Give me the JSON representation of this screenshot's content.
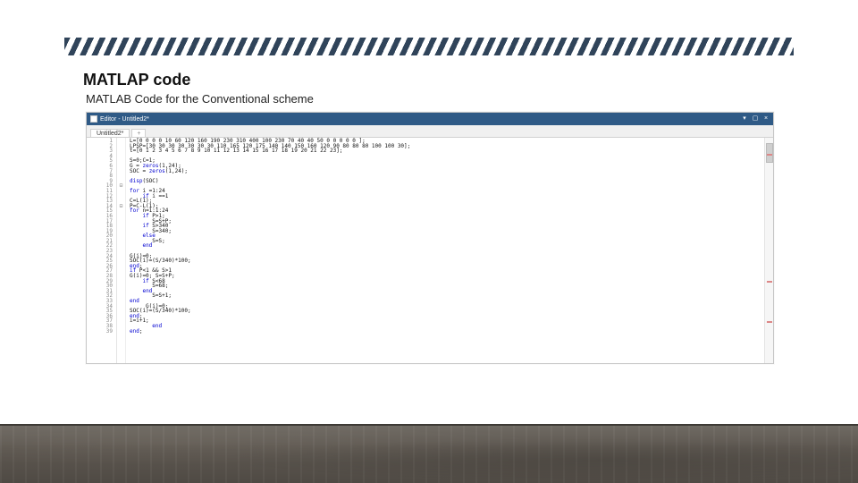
{
  "title": "MATLAP code",
  "subtitle": "MATLAB Code for the Conventional scheme",
  "editor": {
    "windowLabel": "Editor - Untitled2*",
    "min": "▾",
    "max": "▢",
    "close": "×",
    "tab": "Untitled2*",
    "tabPlus": "+",
    "lines": [
      "L=[0 0 0 0 10 60 120 160 190 230 310 400 100 230 70 40 40 50 0 0 0 0 0 ];",
      "LPSP=[30 30 30 30 30 30 30 110 165 120 175 140 140 150 160 120 90 80 80 80 100 100 30];",
      "t=[0 1 2 3 4 5 6 7 8 9 10 11 12 13 14 15 16 17 18 19 20 21 22 23];",
      "",
      "S=0;C=1;",
      "G = zeros(1,24);",
      "SOC = zeros(1,24);",
      "",
      "disp(SOC)",
      "",
      "for i =1:24",
      "    if i ==1",
      "C=L(1);",
      "P=C-L(1);",
      "for n=1:1:24",
      "    if P>1;",
      "       S=S+P;",
      "    if S>340",
      "       S=340;",
      "    else",
      "       S=S;",
      "    end",
      "",
      "G(i)=0;",
      "SOC(i)=(S/340)*100;",
      "end;",
      "if P<1 && S>1",
      "G(i)=0; S=S+P;",
      "    if S<68",
      "       S=68;",
      "    end",
      "       S=S+1;",
      "end",
      "     G(i)=0;",
      "SOC(i)=(S/340)*100;",
      "end;",
      "i=i+1;",
      "       end",
      "end;"
    ],
    "folds": {
      "10": "⊟",
      "14": "⊟"
    },
    "scrollMarks": [
      18,
      160,
      205
    ]
  }
}
